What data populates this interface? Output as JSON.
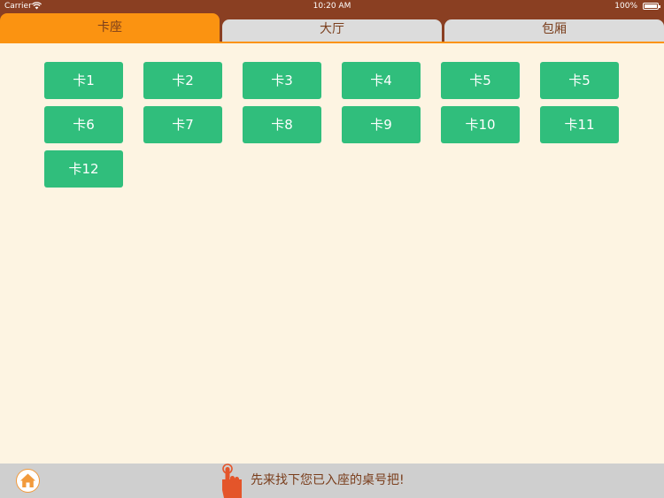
{
  "status_bar": {
    "carrier": "Carrier",
    "time": "10:20 AM",
    "battery": "100%"
  },
  "tabs": [
    {
      "label": "卡座",
      "active": true
    },
    {
      "label": "大厅",
      "active": false
    },
    {
      "label": "包厢",
      "active": false
    }
  ],
  "seats": [
    "卡1",
    "卡2",
    "卡3",
    "卡4",
    "卡5",
    "卡5",
    "卡6",
    "卡7",
    "卡8",
    "卡9",
    "卡10",
    "卡11",
    "卡12"
  ],
  "bottom_bar": {
    "hint": "先来找下您已入座的桌号把!"
  },
  "colors": {
    "brand_brown": "#8a3f22",
    "tab_active": "#fb9311",
    "seat_green": "#30be7c",
    "background": "#fdf4e2"
  },
  "icons": {
    "home": "home-icon",
    "hint": "pointing-hand-icon",
    "wifi": "wifi-icon",
    "battery": "battery-icon"
  }
}
